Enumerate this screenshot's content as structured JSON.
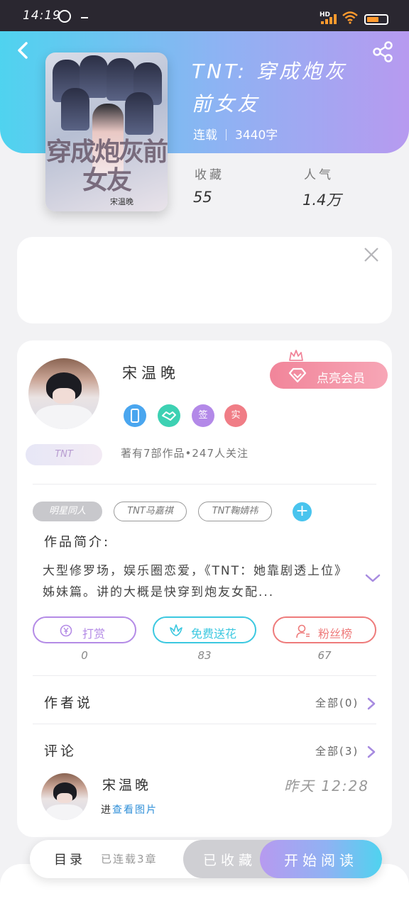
{
  "status_bar": {
    "time": "14:19",
    "network": "HD",
    "battery_color": "#ff9a2e"
  },
  "book": {
    "title_line1": "TNT: 穿成炮灰",
    "title_line2": "前女友",
    "status": "连载",
    "word_count": "3440字",
    "cover_title": "穿成炮灰前女友",
    "cover_author": "宋温晚"
  },
  "stats": {
    "favorites_label": "收藏",
    "favorites_value": "55",
    "popularity_label": "人气",
    "popularity_value": "1.4万"
  },
  "author": {
    "name": "宋温晚",
    "vip_button": "点亮会员",
    "tag": "TNT",
    "works_info": "著有7部作品•247人关注",
    "badges": [
      {
        "name": "phone-badge",
        "text": "",
        "color": "#4aa6ef"
      },
      {
        "name": "hands-badge",
        "text": "",
        "color": "#3dd1b3"
      },
      {
        "name": "signed-badge",
        "text": "签",
        "color": "#b389e8"
      },
      {
        "name": "real-badge",
        "text": "实",
        "color": "#f07d86"
      }
    ]
  },
  "tags": [
    "明星同人",
    "TNT马嘉祺",
    "TNT鞠婧祎"
  ],
  "intro": {
    "label": "作品简介:",
    "text": "大型修罗场，娱乐圈恋爱，《TNT：她靠剧透上位》姊妹篇。讲的大概是快穿到炮友女配..."
  },
  "actions": [
    {
      "label": "打赏",
      "count": "0",
      "color": "#b48be6"
    },
    {
      "label": "免费送花",
      "count": "83",
      "color": "#3cc8e0"
    },
    {
      "label": "粉丝榜",
      "count": "67",
      "color": "#ee7b7b"
    }
  ],
  "author_notes": {
    "label": "作者说",
    "more": "全部(0)"
  },
  "comments": {
    "label": "评论",
    "more": "全部(3)",
    "items": [
      {
        "name": "宋温晚",
        "time": "昨天 12:28",
        "prefix": "进",
        "link": "查看图片"
      }
    ]
  },
  "bottom_bar": {
    "toc": "目录",
    "chapters": "已连载3章",
    "collected": "已收藏",
    "read": "开始阅读"
  },
  "colors": {
    "accent_blue": "#4fd3ef",
    "accent_purple": "#b79af0",
    "vip_pink": "#f1859a",
    "chevron": "#a78be0"
  }
}
